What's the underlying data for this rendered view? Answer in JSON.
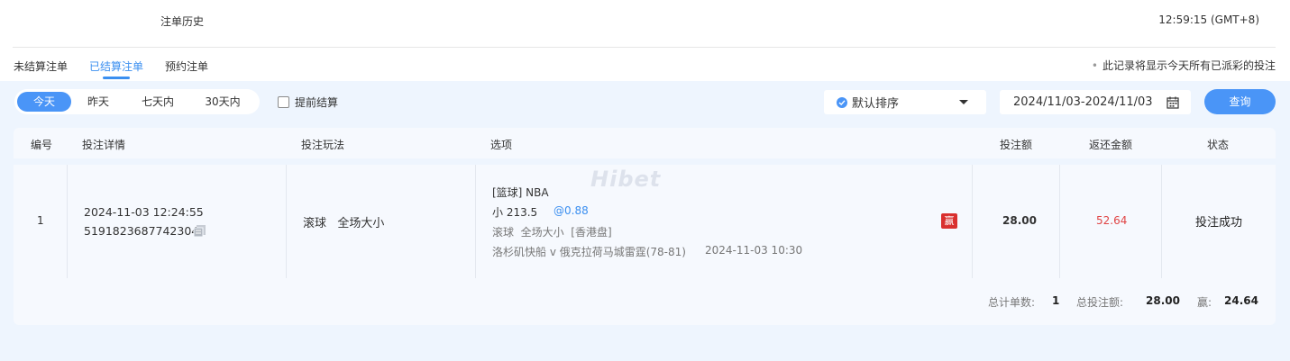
{
  "header": {
    "title": "注单历史",
    "clock": "12:59:15 (GMT+8)"
  },
  "tabs": [
    {
      "label": "未结算注单",
      "active": false
    },
    {
      "label": "已结算注单",
      "active": true
    },
    {
      "label": "预约注单",
      "active": false
    }
  ],
  "notice": "此记录将显示今天所有已派彩的投注",
  "filters": {
    "ranges": [
      "今天",
      "昨天",
      "七天内",
      "30天内"
    ],
    "selected_range": "今天",
    "early_settle_label": "提前结算",
    "early_settle_checked": false,
    "sort_label": "默认排序",
    "date_range": "2024/11/03-2024/11/03",
    "query_label": "查询"
  },
  "table": {
    "headers": [
      "编号",
      "投注详情",
      "投注玩法",
      "选项",
      "投注额",
      "返还金额",
      "状态"
    ],
    "rows": [
      {
        "index": "1",
        "datetime": "2024-11-03 12:24:55",
        "ticket_no": "5191823687742304",
        "play": "滚球   全场大小",
        "option_sport": "[篮球] NBA",
        "option_pick": "小 213.5",
        "option_odds": "@0.88",
        "option_market": "滚球  全场大小  [香港盘]",
        "option_match": "洛杉矶快船 v 俄克拉荷马城雷霆(78-81)",
        "option_time": "2024-11-03 10:30",
        "result_badge": "赢",
        "stake": "28.00",
        "return": "52.64",
        "status": "投注成功"
      }
    ]
  },
  "summary": {
    "count_label": "总计单数:",
    "count": "1",
    "total_label": "总投注额:",
    "total": "28.00",
    "win_label": "赢:",
    "win": "24.64"
  },
  "watermark": "Hibet",
  "colors": {
    "accent": "#4a95f7",
    "win_red": "#d9302f",
    "return_red": "#e04545",
    "odds_blue": "#3b8ff0"
  }
}
